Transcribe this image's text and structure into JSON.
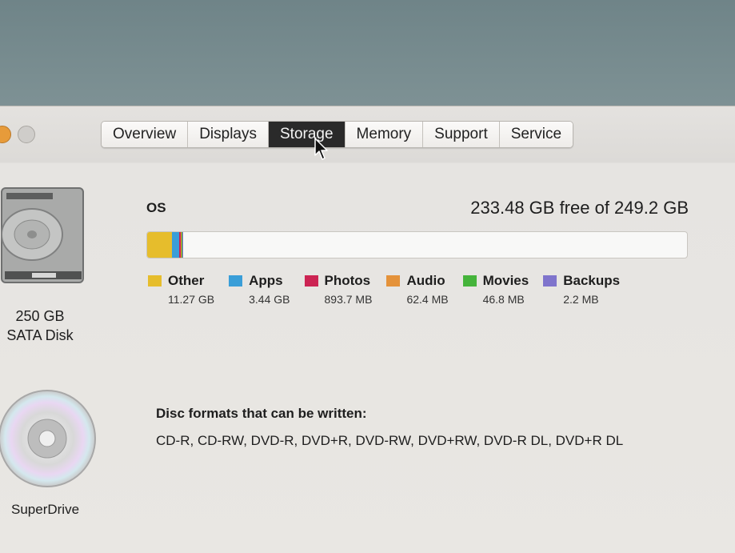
{
  "tabs": [
    "Overview",
    "Displays",
    "Storage",
    "Memory",
    "Support",
    "Service"
  ],
  "active_tab": "Storage",
  "disk": {
    "capacity": "250 GB",
    "type": "SATA Disk"
  },
  "volume": {
    "name": "OS",
    "free_text": "233.48 GB free of 249.2 GB",
    "total_gb": 249.2,
    "categories": [
      {
        "label": "Other",
        "size": "11.27 GB",
        "gb": 11.27,
        "color": "#e6bd2c"
      },
      {
        "label": "Apps",
        "size": "3.44 GB",
        "gb": 3.44,
        "color": "#3a9ed8"
      },
      {
        "label": "Photos",
        "size": "893.7 MB",
        "gb": 0.8937,
        "color": "#cc2453"
      },
      {
        "label": "Audio",
        "size": "62.4 MB",
        "gb": 0.0624,
        "color": "#e4923a"
      },
      {
        "label": "Movies",
        "size": "46.8 MB",
        "gb": 0.0468,
        "color": "#45b43b"
      },
      {
        "label": "Backups",
        "size": "2.2 MB",
        "gb": 0.0022,
        "color": "#7f74cc"
      }
    ]
  },
  "optical": {
    "name": "SuperDrive",
    "formats_title": "Disc formats that can be written:",
    "formats": "CD-R, CD-RW, DVD-R, DVD+R, DVD-RW, DVD+RW, DVD-R DL, DVD+R DL"
  },
  "icons": {
    "disk": "hard-disk-icon",
    "disc": "superdrive-disc-icon",
    "cursor": "mouse-pointer-icon"
  }
}
